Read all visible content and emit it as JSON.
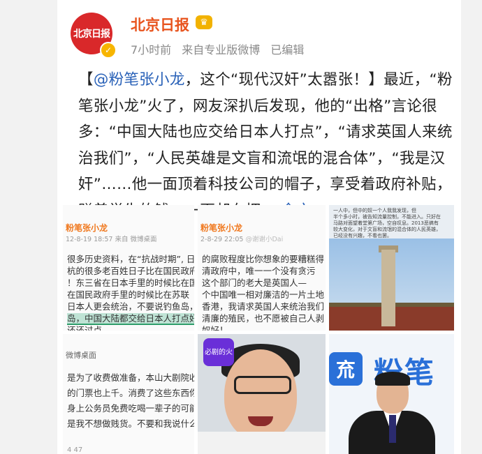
{
  "account": {
    "avatar_text": "北京日报",
    "name": "北京日报",
    "badge_icon": "crown-icon",
    "time": "7小时前",
    "source": "来自专业版微博",
    "edited": "已编辑"
  },
  "post": {
    "open_bracket": "【",
    "mention": "@粉笔张小龙",
    "headline": "，这个“现代汉奸”太嚣张！】",
    "body": "最近，“粉笔张小龙”火了，网友深扒后发现，他的“出格”言论很多：“中国大陆也应交给日本人打点”，“请求英国人来统治我们”，“人民英雄是文盲和流氓的混合体”，“我是汉奸”……他一面顶着科技公司的帽子，享受着政府补贴，赚着学生的钱；一面却在拥...",
    "more_label": "全文"
  },
  "images": {
    "img1": {
      "head": "粉笔张小龙",
      "date": "12-8-19 18:57  来自 微博桌面",
      "lines": [
        "很多历史资料，在“抗战时期”, 日",
        "杭的很多老百姓日子比在国民政府",
        "！东三省在日本手里的时候比在国",
        "在国民政府手里的时候比在苏联",
        "日本人更会统治，不要说钓鱼岛，",
        "岛，中国大陆都交给日本人打点好",
        "还还过点"
      ]
    },
    "img2": {
      "head": "粉笔张小龙",
      "date": "2-8-29 22:05",
      "watermark": "@谢谢小Dai",
      "lines": [
        "的腐败程度比你想象的要糟糕得",
        "清政府中，唯一一个没有贪污",
        "这个部门的老大是英国人—",
        "个中国唯一相对廉洁的一片土地",
        "香港，我请求英国人来统治我们",
        "清廉的殖民，也不愿被自己人剥",
        "奴好！"
      ]
    },
    "img3": {
      "lines": [
        "一人中，但中的奴一个人我我发现，但",
        "半个多小时，被告知流量控制，不能进入。只好在",
        "马路对面望着堂第广场，空自叹息。2013恶搞有",
        "较大变化，对于文盲和流氓的混合体的人民英雄，",
        "已经没有兴趣，不看也罢。"
      ]
    },
    "img4": {
      "head": "微博桌面",
      "lines": [
        "是为了收费做准备，本山大剧院收",
        "的门票也上千。消费了这些东西你",
        "身上公务员免费吃喝一辈子的可能",
        "是我不想做贱货。不要和我说什么"
      ],
      "footer": "4   47"
    },
    "img5": {
      "app_logo": "必剧的火"
    },
    "img6": {
      "brand_logo": "㐬",
      "brand_text": "粉笔"
    }
  }
}
